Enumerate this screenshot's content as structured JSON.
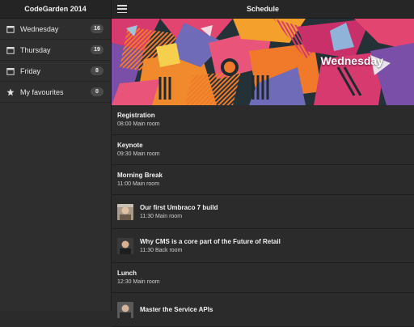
{
  "sidebar": {
    "title": "CodeGarden 2014",
    "items": [
      {
        "label": "Wednesday",
        "count": "16",
        "icon": "calendar-icon"
      },
      {
        "label": "Thursday",
        "count": "19",
        "icon": "calendar-icon"
      },
      {
        "label": "Friday",
        "count": "8",
        "icon": "calendar-icon"
      },
      {
        "label": "My favourites",
        "count": "0",
        "icon": "star-icon"
      }
    ]
  },
  "header": {
    "title": "Schedule",
    "menu_icon": "hamburger-menu-icon"
  },
  "hero": {
    "title": "Wednesday"
  },
  "sessions": [
    {
      "title": "Registration",
      "time": "08:00",
      "room": "Main room"
    },
    {
      "title": "Keynote",
      "time": "09:30",
      "room": "Main room"
    },
    {
      "title": "Morning Break",
      "time": "11:00",
      "room": "Main room"
    },
    {
      "title": "Our first Umbraco 7 build",
      "time": "11:30",
      "room": "Main room"
    },
    {
      "title": "Why CMS is a core part of the Future of Retail",
      "time": "11:30",
      "room": "Back room"
    },
    {
      "title": "Lunch",
      "time": "12:30",
      "room": "Main room"
    },
    {
      "title": "Master the Service APIs",
      "time": "",
      "room": ""
    }
  ],
  "colors": {
    "background": "#2b2b2b",
    "sidebar": "#2e2e2e",
    "header": "#262626",
    "badge": "#4a4a4a"
  }
}
